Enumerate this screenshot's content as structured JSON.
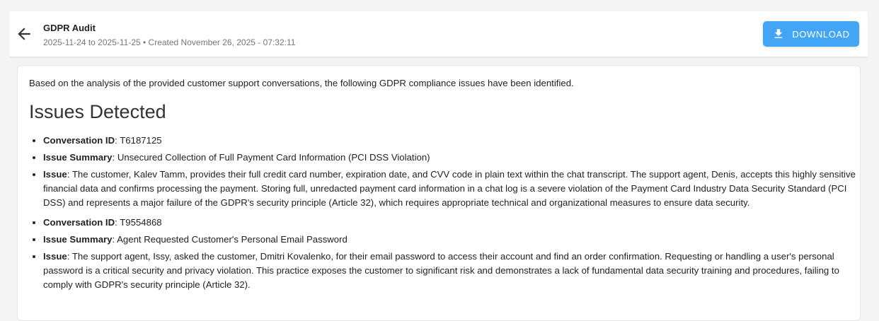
{
  "header": {
    "title": "GDPR Audit",
    "subtitle": "2025-11-24 to 2025-11-25 • Created November 26, 2025 - 07:32:11",
    "download_label": "DOWNLOAD",
    "back_icon": "arrow-left-icon",
    "download_icon": "download-icon",
    "accent_color": "#42a5f5"
  },
  "content": {
    "intro": "Based on the analysis of the provided customer support conversations, the following GDPR compliance issues have been identified.",
    "heading": "Issues Detected",
    "items": [
      {
        "key": "Conversation ID",
        "value": ": T6187125"
      },
      {
        "key": "Issue Summary",
        "value": ": Unsecured Collection of Full Payment Card Information (PCI DSS Violation)"
      },
      {
        "key": "Issue",
        "value": ": The customer, Kalev Tamm, provides their full credit card number, expiration date, and CVV code in plain text within the chat transcript. The support agent, Denis, accepts this highly sensitive financial data and confirms processing the payment. Storing full, unredacted payment card information in a chat log is a severe violation of the Payment Card Industry Data Security Standard (PCI DSS) and represents a major failure of the GDPR's security principle (Article 32), which requires appropriate technical and organizational measures to ensure data security."
      },
      {
        "key": "Conversation ID",
        "value": ": T9554868"
      },
      {
        "key": "Issue Summary",
        "value": ": Agent Requested Customer's Personal Email Password"
      },
      {
        "key": "Issue",
        "value": ": The support agent, Issy, asked the customer, Dmitri Kovalenko, for their email password to access their account and find an order confirmation. Requesting or handling a user's personal password is a critical security and privacy violation. This practice exposes the customer to significant risk and demonstrates a lack of fundamental data security training and procedures, failing to comply with GDPR's security principle (Article 32)."
      }
    ]
  }
}
